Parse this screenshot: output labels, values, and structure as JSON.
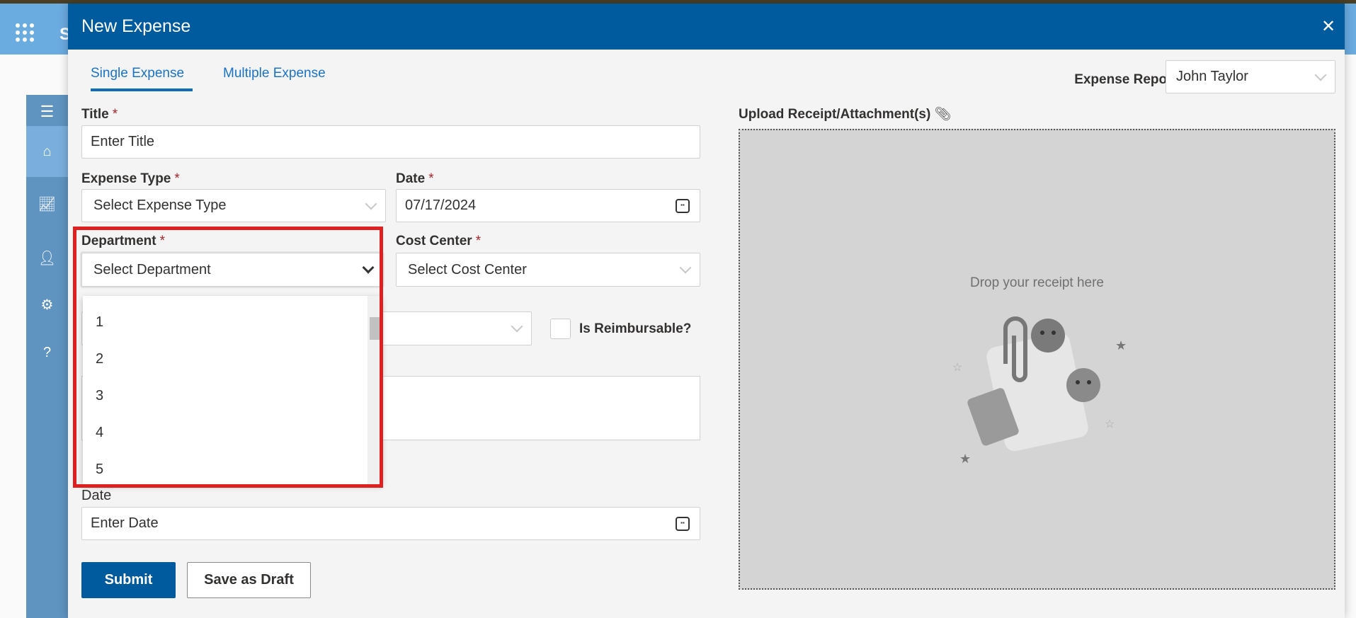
{
  "app": {
    "letter": "S"
  },
  "sidebar": {
    "items": [
      {
        "icon": "menu-icon"
      },
      {
        "icon": "home-icon"
      },
      {
        "icon": "chart-icon"
      },
      {
        "icon": "user-settings-icon"
      },
      {
        "icon": "gear-icon"
      },
      {
        "icon": "help-icon",
        "label": "?"
      }
    ]
  },
  "modal": {
    "title": "New Expense",
    "close": "✕"
  },
  "tabs": [
    {
      "label": "Single Expense",
      "active": true
    },
    {
      "label": "Multiple Expense",
      "active": false
    }
  ],
  "reported_by": {
    "label": "Expense Reported By",
    "required": "*",
    "value": "John Taylor"
  },
  "form": {
    "title": {
      "label": "Title",
      "required": "*",
      "placeholder": "Enter Title"
    },
    "expense_type": {
      "label": "Expense Type",
      "required": "*",
      "placeholder": "Select Expense Type"
    },
    "date": {
      "label": "Date",
      "required": "*",
      "value": "07/17/2024"
    },
    "department": {
      "label": "Department",
      "required": "*",
      "placeholder": "Select Department",
      "options": [
        "1",
        "2",
        "3",
        "4",
        "5"
      ]
    },
    "cost_center": {
      "label": "Cost Center",
      "required": "*",
      "placeholder": "Select Cost Center"
    },
    "reimbursable": {
      "label": "Is Reimbursable?",
      "checked": false
    },
    "date2": {
      "label": "Date",
      "placeholder": "Enter Date"
    }
  },
  "buttons": {
    "submit": "Submit",
    "draft": "Save as Draft"
  },
  "upload": {
    "label": "Upload Receipt/Attachment(s)",
    "drop_text": "Drop your receipt here"
  },
  "colors": {
    "header": "#005a9e",
    "accent": "#0f6cbd",
    "highlight": "#e02020"
  }
}
